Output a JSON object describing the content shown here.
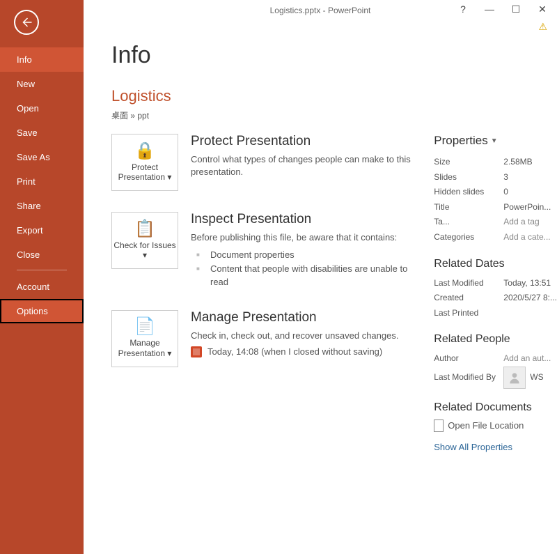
{
  "window": {
    "title": "Logistics.pptx - PowerPoint"
  },
  "sidebar": {
    "items": [
      {
        "label": "Info",
        "active": true
      },
      {
        "label": "New"
      },
      {
        "label": "Open"
      },
      {
        "label": "Save"
      },
      {
        "label": "Save As"
      },
      {
        "label": "Print"
      },
      {
        "label": "Share"
      },
      {
        "label": "Export"
      },
      {
        "label": "Close"
      }
    ],
    "footer": [
      {
        "label": "Account"
      },
      {
        "label": "Options",
        "highlighted": true
      }
    ]
  },
  "page": {
    "title": "Info",
    "doc_name": "Logistics",
    "doc_path": "桌面 » ppt"
  },
  "actions": {
    "protect": {
      "tile_label": "Protect Presentation",
      "heading": "Protect Presentation",
      "desc": "Control what types of changes people can make to this presentation."
    },
    "inspect": {
      "tile_label": "Check for Issues",
      "heading": "Inspect Presentation",
      "desc": "Before publishing this file, be aware that it contains:",
      "bullets": [
        "Document properties",
        "Content that people with disabilities are unable to read"
      ]
    },
    "manage": {
      "tile_label": "Manage Presentation",
      "heading": "Manage Presentation",
      "desc": "Check in, check out, and recover unsaved changes.",
      "autosave": "Today, 14:08 (when I closed without saving)"
    }
  },
  "props": {
    "heading": "Properties",
    "rows": [
      {
        "k": "Size",
        "v": "2.58MB"
      },
      {
        "k": "Slides",
        "v": "3"
      },
      {
        "k": "Hidden slides",
        "v": "0"
      },
      {
        "k": "Title",
        "v": "PowerPoin..."
      },
      {
        "k": "Ta...",
        "v": "Add a tag",
        "ph": true
      },
      {
        "k": "Categories",
        "v": "Add a cate...",
        "ph": true
      }
    ],
    "dates": {
      "heading": "Related Dates",
      "rows": [
        {
          "k": "Last Modified",
          "v": "Today, 13:51"
        },
        {
          "k": "Created",
          "v": "2020/5/27 8:..."
        },
        {
          "k": "Last Printed",
          "v": ""
        }
      ]
    },
    "people": {
      "heading": "Related People",
      "author_k": "Author",
      "author_v": "Add an aut...",
      "modby_k": "Last Modified By",
      "modby_name": "WS"
    },
    "docs": {
      "heading": "Related Documents",
      "open_loc": "Open File Location",
      "show_all": "Show All Properties"
    }
  }
}
